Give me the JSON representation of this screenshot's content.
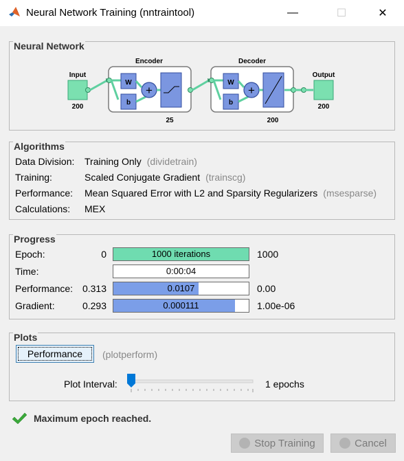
{
  "window": {
    "title": "Neural Network Training (nntraintool)",
    "min_glyph": "—",
    "max_glyph": "☐",
    "close_glyph": "✕"
  },
  "network_panel": {
    "title": "Neural Network",
    "input": {
      "label": "Input",
      "size": "200"
    },
    "encoder": {
      "label": "Encoder",
      "size": "25"
    },
    "decoder": {
      "label": "Decoder",
      "size": "200"
    },
    "output": {
      "label": "Output",
      "size": "200"
    },
    "w_label": "W",
    "b_label": "b"
  },
  "algorithms": {
    "title": "Algorithms",
    "rows": [
      {
        "label": "Data Division:",
        "value": "Training Only",
        "hint": "(dividetrain)"
      },
      {
        "label": "Training:",
        "value": "Scaled Conjugate Gradient",
        "hint": "(trainscg)"
      },
      {
        "label": "Performance:",
        "value": "Mean Squared Error with L2 and Sparsity Regularizers",
        "hint": "(msesparse)"
      },
      {
        "label": "Calculations:",
        "value": "MEX",
        "hint": ""
      }
    ]
  },
  "progress": {
    "title": "Progress",
    "rows": [
      {
        "label": "Epoch:",
        "start": "0",
        "bar_text": "1000 iterations",
        "end": "1000",
        "fill": 1.0,
        "color": "#6fdcb0"
      },
      {
        "label": "Time:",
        "start": "",
        "bar_text": "0:00:04",
        "end": "",
        "fill": 0.0,
        "color": "#ffffff"
      },
      {
        "label": "Performance:",
        "start": "0.313",
        "bar_text": "0.0107",
        "end": "0.00",
        "fill": 0.63,
        "color": "#7b9ee8"
      },
      {
        "label": "Gradient:",
        "start": "0.293",
        "bar_text": "0.000111",
        "end": "1.00e-06",
        "fill": 0.9,
        "color": "#7b9ee8"
      }
    ]
  },
  "plots": {
    "title": "Plots",
    "button_label": "Performance",
    "button_hint": "(plotperform)",
    "interval_label": "Plot Interval:",
    "interval_value": "1 epochs",
    "slider_position": 0.0
  },
  "status": {
    "icon": "checkmark-icon",
    "message": "Maximum epoch reached."
  },
  "buttons": {
    "stop": "Stop Training",
    "cancel": "Cancel"
  },
  "colors": {
    "input_block": "#7be0b0",
    "weight_block": "#7b96e0",
    "connection": "#5fd0a0",
    "disabled_button": "#cccccc"
  }
}
